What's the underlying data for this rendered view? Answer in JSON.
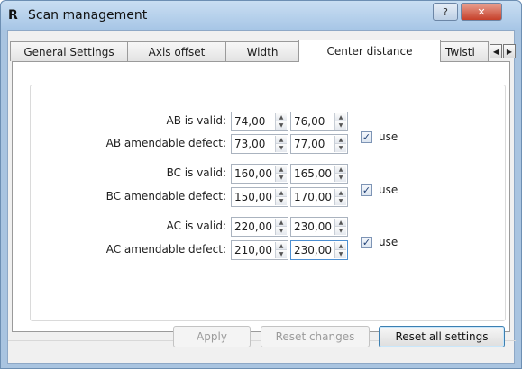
{
  "window": {
    "logo": "R",
    "title": "Scan management",
    "help_label": "?",
    "close_label": "✕"
  },
  "tabs": [
    {
      "label": "General Settings",
      "active": false
    },
    {
      "label": "Axis offset",
      "active": false
    },
    {
      "label": "Width",
      "active": false
    },
    {
      "label": "Center distance",
      "active": true
    },
    {
      "label": "Twisti",
      "active": false
    }
  ],
  "tab_scroll": {
    "left": "◀",
    "right": "▶"
  },
  "center_distance": {
    "rows": [
      {
        "label": "AB is valid:",
        "min": "74,00",
        "max": "76,00"
      },
      {
        "label": "AB amendable defect:",
        "min": "73,00",
        "max": "77,00"
      },
      {
        "label": "BC is valid:",
        "min": "160,00",
        "max": "165,00"
      },
      {
        "label": "BC amendable defect:",
        "min": "150,00",
        "max": "170,00"
      },
      {
        "label": "AC is valid:",
        "min": "220,00",
        "max": "230,00"
      },
      {
        "label": "AC amendable defect:",
        "min": "210,00",
        "max": "230,00"
      }
    ],
    "use_checks": [
      {
        "label": "use",
        "checked": true
      },
      {
        "label": "use",
        "checked": true
      },
      {
        "label": "use",
        "checked": true
      }
    ],
    "check_glyph": "✓",
    "spin_up": "▲",
    "spin_down": "▼"
  },
  "buttons": {
    "apply": "Apply",
    "reset_changes": "Reset changes",
    "reset_all": "Reset all settings"
  },
  "colors": {
    "title_bar": "#a7c6e6",
    "close_button": "#c6402a",
    "accent_border": "#3c7fb1"
  }
}
